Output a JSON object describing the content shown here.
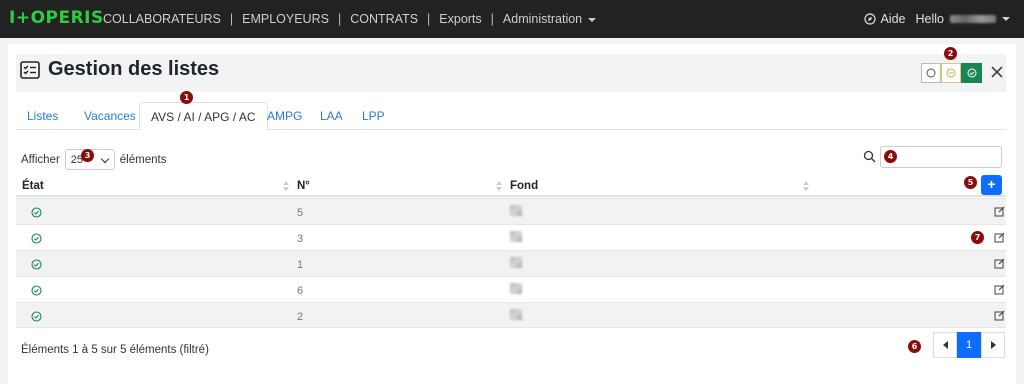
{
  "navbar": {
    "brand": "I+OPERIS",
    "links": [
      "COLLABORATEURS",
      "EMPLOYEURS",
      "CONTRATS",
      "Exports",
      "Administration"
    ],
    "aide": "Aide",
    "hello": "Hello"
  },
  "page": {
    "title": "Gestion des listes"
  },
  "tabs": [
    "Listes",
    "Vacances",
    "AVS / AI / APG / AC",
    "AMPG",
    "LAA",
    "LPP"
  ],
  "active_tab": "AVS / AI / APG / AC",
  "length": {
    "prefix": "Afficher",
    "value": "25",
    "suffix": "éléments"
  },
  "table": {
    "columns": [
      "État",
      "N°",
      "Fond"
    ],
    "rows": [
      {
        "num": "5"
      },
      {
        "num": "3"
      },
      {
        "num": "1"
      },
      {
        "num": "6"
      },
      {
        "num": "2"
      }
    ],
    "add_label": "+"
  },
  "info": "Éléments 1 à 5 sur 5 éléments (filtré)",
  "pagination": {
    "current": "1"
  },
  "badges": [
    "1",
    "2",
    "3",
    "4",
    "5",
    "6",
    "7"
  ],
  "colors": {
    "brand": "#2ecc40",
    "primary": "#0d6efd",
    "success": "#198754",
    "badge": "#8b0b0b"
  }
}
